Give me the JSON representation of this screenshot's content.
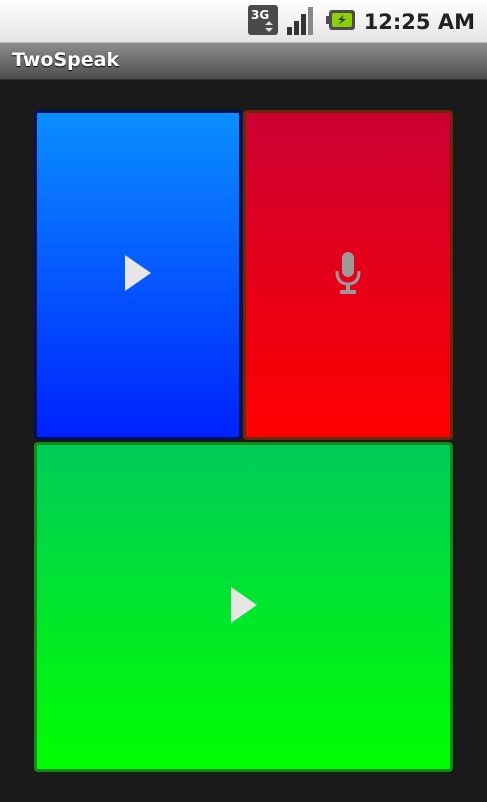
{
  "status_bar": {
    "time": "12:25 AM",
    "network_label": "3G",
    "icons": [
      "3g-data-icon",
      "signal-strength-icon",
      "battery-charging-icon"
    ]
  },
  "title_bar": {
    "title": "TwoSpeak"
  },
  "panels": [
    {
      "name": "blue-play-panel",
      "color_top": "#0a8fff",
      "color_bottom": "#0022ff",
      "icon": "play-icon"
    },
    {
      "name": "red-record-panel",
      "color_top": "#cc0033",
      "color_bottom": "#ff0000",
      "icon": "microphone-icon"
    },
    {
      "name": "green-play-panel",
      "color_top": "#00cc5a",
      "color_bottom": "#00ff00",
      "icon": "play-icon"
    }
  ]
}
